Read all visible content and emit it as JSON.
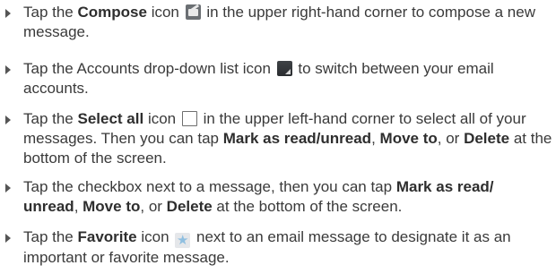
{
  "bullets": [
    {
      "t1": "Tap the ",
      "b1": "Compose",
      "t2": " icon ",
      "icon": "compose-icon",
      "t3": " in the upper right-hand corner to compose a new message."
    },
    {
      "t1": "Tap the Accounts drop-down list icon ",
      "icon": "accounts-dropdown-icon",
      "t2": " to switch between your email accounts."
    },
    {
      "t1": "Tap the ",
      "b1": "Select all",
      "t2": " icon ",
      "icon": "select-all-icon",
      "t3": " in the upper left-hand corner to select all of your messages. Then you can tap ",
      "b2": "Mark as read/unread",
      "t4": ", ",
      "b3": "Move to",
      "t5": ", or ",
      "b4": "Delete",
      "t6": " at the bottom of the screen."
    },
    {
      "t1": "Tap the checkbox next to a message, then you can tap ",
      "b1": "Mark as read/ unread",
      "t2": ", ",
      "b2": "Move to",
      "t3": ", or ",
      "b3": "Delete",
      "t4": " at the bottom of the screen."
    },
    {
      "t1": "Tap the ",
      "b1": "Favorite",
      "t2": " icon ",
      "icon": "favorite-star-icon",
      "t3": " next to an email message to designate it as an important or favorite message."
    }
  ]
}
